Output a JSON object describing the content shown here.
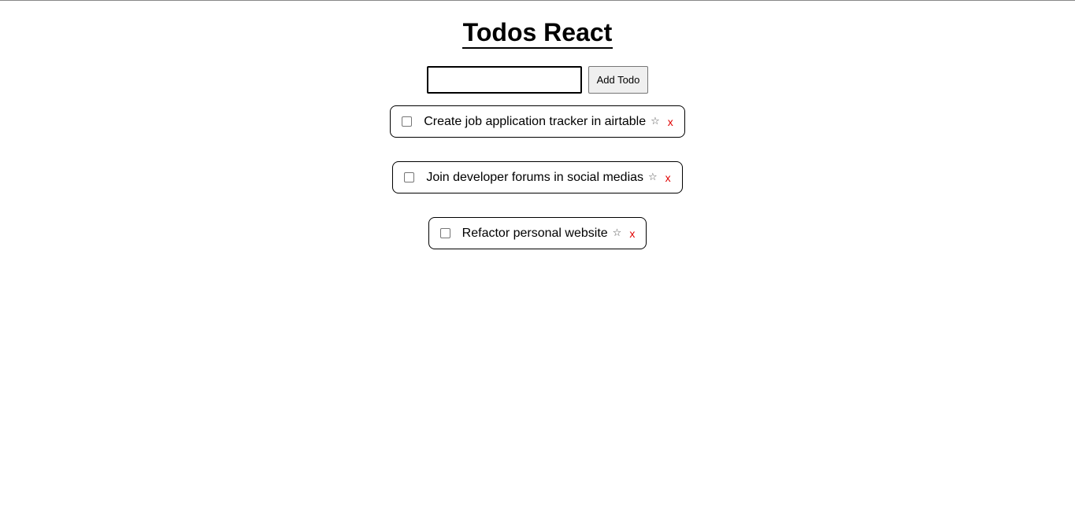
{
  "header": {
    "title": "Todos React"
  },
  "form": {
    "input_value": "",
    "input_placeholder": "",
    "add_label": "Add Todo"
  },
  "todos": [
    {
      "text": "Create job application tracker in airtable",
      "completed": false,
      "star": "☆",
      "delete": "x"
    },
    {
      "text": "Join developer forums in social medias",
      "completed": false,
      "star": "☆",
      "delete": "x"
    },
    {
      "text": "Refactor personal website",
      "completed": false,
      "star": "☆",
      "delete": "x"
    }
  ],
  "colors": {
    "delete": "#e00000",
    "border": "#000000"
  }
}
